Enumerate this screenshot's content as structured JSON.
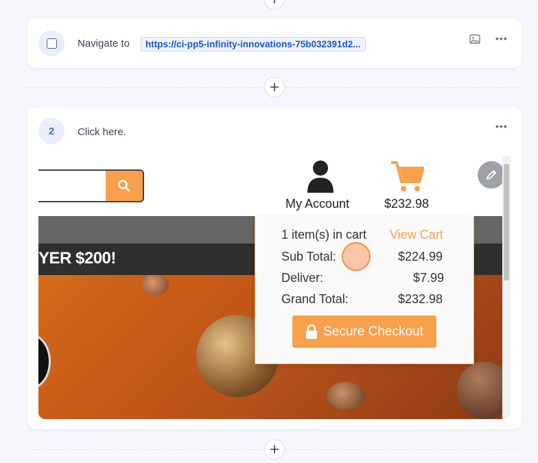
{
  "steps": [
    {
      "type": "navigate",
      "text": "Navigate to",
      "url": "https://ci-pp5-infinity-innovations-75b032391d2..."
    },
    {
      "number": "2",
      "text": "Click here."
    }
  ],
  "menu_glyph": "•••",
  "screenshot": {
    "promo_text": "YER $200!",
    "header": {
      "account_label": "My Account",
      "cart_total": "$232.98"
    },
    "cart_dropdown": {
      "items_label": "1 item(s) in cart",
      "view_cart": "View Cart",
      "rows": [
        {
          "label": "Sub Total:",
          "value": "$224.99"
        },
        {
          "label": "Deliver:",
          "value": "$7.99"
        },
        {
          "label": "Grand Total:",
          "value": "$232.98"
        }
      ],
      "checkout_label": "Secure Checkout"
    }
  },
  "colors": {
    "accent_orange": "#f8a04c",
    "step_blue": "#4e63d8",
    "url_blue": "#1a56c4"
  },
  "icons": [
    "plus-icon",
    "image-icon",
    "more-icon",
    "search-icon",
    "user-icon",
    "cart-icon",
    "lock-icon",
    "pencil-icon"
  ]
}
